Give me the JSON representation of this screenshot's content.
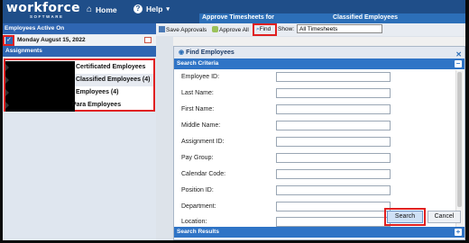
{
  "app": {
    "logo": "workforce",
    "logo_sub": "SOFTWARE"
  },
  "nav": {
    "home": "Home",
    "help": "Help"
  },
  "header_strip": {
    "title": "Approve Timesheets for",
    "group": "Classified Employees"
  },
  "left": {
    "header": "Employees Active On",
    "date": "Monday August 15, 2022",
    "assignments_header": "Assignments",
    "assignments": [
      {
        "label": "Certificated Employees"
      },
      {
        "label": "Classified Employees (4)"
      },
      {
        "label": "Employees (4)"
      },
      {
        "label": "Para Employees"
      }
    ]
  },
  "toolbar": {
    "save": "Save Approvals",
    "approve_all": "Approve All",
    "find": "Find",
    "show_label": "Show:",
    "show_value": "All Timesheets"
  },
  "dialog": {
    "title": "Find Employees",
    "criteria_header": "Search Criteria",
    "fields": [
      {
        "label": "Employee ID:"
      },
      {
        "label": "Last Name:"
      },
      {
        "label": "First Name:"
      },
      {
        "label": "Middle Name:"
      },
      {
        "label": "Assignment ID:"
      },
      {
        "label": "Pay Group:"
      },
      {
        "label": "Calendar Code:"
      },
      {
        "label": "Position ID:"
      },
      {
        "label": "Department:"
      },
      {
        "label": "Location:"
      }
    ],
    "search_button": "Search",
    "cancel_button": "Cancel",
    "results_header": "Search Results"
  },
  "colors": {
    "brand": "#1f4e89",
    "accent": "#2f74c6",
    "highlight": "#e02020"
  }
}
